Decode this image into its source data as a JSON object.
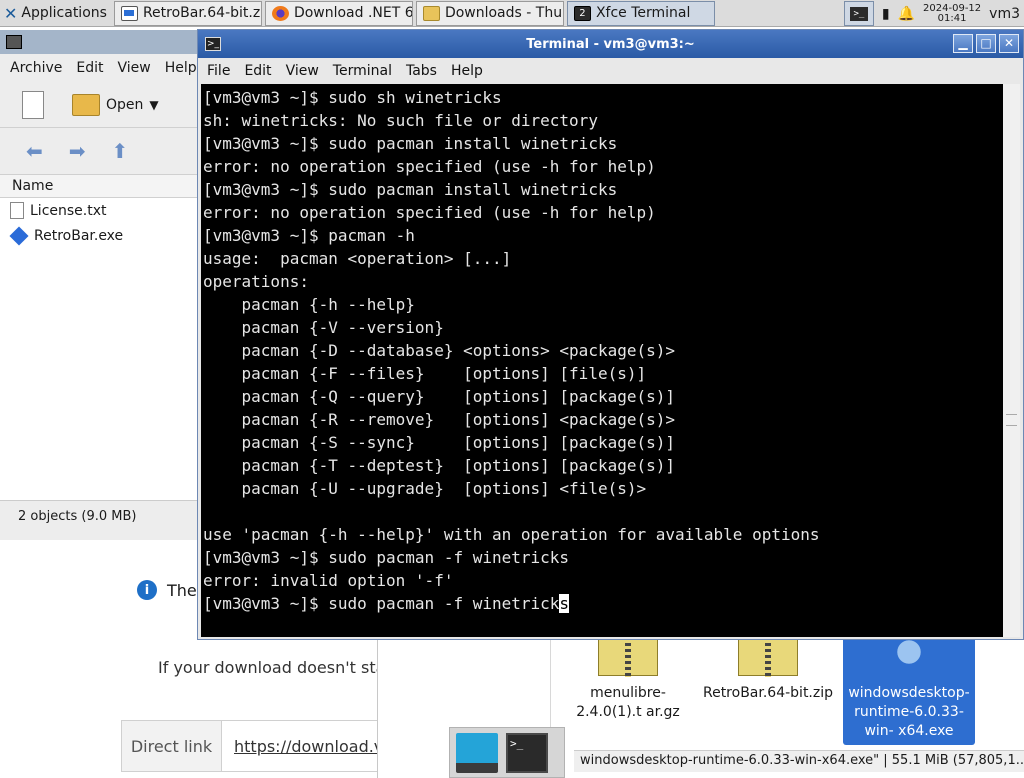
{
  "panel": {
    "applications_label": "Applications",
    "tasks": [
      {
        "label": "RetroBar.64-bit.z...",
        "icon": "retrobar-icon"
      },
      {
        "label": "Download .NET 6...",
        "icon": "firefox-icon"
      },
      {
        "label": "Downloads - Thu...",
        "icon": "folder-icon"
      },
      {
        "label": "Xfce Terminal",
        "icon": "terminal-icon",
        "badge": "2"
      }
    ],
    "clock_date": "2024-09-12",
    "clock_time": "01:41",
    "user": "vm3"
  },
  "browser": {
    "info_text": "The",
    "download_text": "If your download doesn't star",
    "direct_link_label": "Direct link",
    "direct_link_url": "https://download.v"
  },
  "archive": {
    "menu": [
      "Archive",
      "Edit",
      "View",
      "Help"
    ],
    "open_label": "Open",
    "column_name": "Name",
    "files": [
      "License.txt",
      "RetroBar.exe"
    ],
    "status": "2 objects (9.0 MB)"
  },
  "files": {
    "items": [
      {
        "name": "menulibre-2.4.0(1).t ar.gz"
      },
      {
        "name": "RetroBar.64-bit.zip"
      },
      {
        "name": "windowsdesktop- runtime-6.0.33-win- x64.exe",
        "selected": true
      }
    ],
    "status": "windowsdesktop-runtime-6.0.33-win-x64.exe\" | 55.1 MiB (57,805,1..."
  },
  "terminal": {
    "title": "Terminal - vm3@vm3:~",
    "menu": [
      "File",
      "Edit",
      "View",
      "Terminal",
      "Tabs",
      "Help"
    ],
    "lines": [
      "[vm3@vm3 ~]$ sudo sh winetricks",
      "sh: winetricks: No such file or directory",
      "[vm3@vm3 ~]$ sudo pacman install winetricks",
      "error: no operation specified (use -h for help)",
      "[vm3@vm3 ~]$ sudo pacman install winetricks",
      "error: no operation specified (use -h for help)",
      "[vm3@vm3 ~]$ pacman -h",
      "usage:  pacman <operation> [...]",
      "operations:",
      "    pacman {-h --help}",
      "    pacman {-V --version}",
      "    pacman {-D --database} <options> <package(s)>",
      "    pacman {-F --files}    [options] [file(s)]",
      "    pacman {-Q --query}    [options] [package(s)]",
      "    pacman {-R --remove}   [options] <package(s)>",
      "    pacman {-S --sync}     [options] [package(s)]",
      "    pacman {-T --deptest}  [options] [package(s)]",
      "    pacman {-U --upgrade}  [options] <file(s)>",
      "",
      "use 'pacman {-h --help}' with an operation for available options",
      "[vm3@vm3 ~]$ sudo pacman -f winetricks",
      "error: invalid option '-f'"
    ],
    "current_prompt": "[vm3@vm3 ~]$ sudo pacman -f winetrick",
    "cursor_char": "s"
  }
}
